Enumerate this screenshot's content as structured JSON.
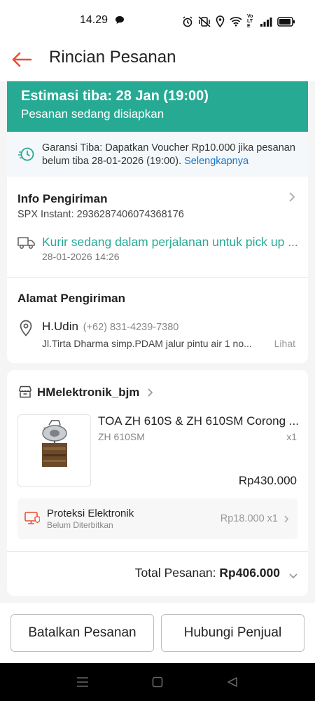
{
  "status_bar": {
    "time": "14.29",
    "network_label": "Vo LTE"
  },
  "header": {
    "title": "Rincian Pesanan"
  },
  "banner": {
    "estimate": "Estimasi tiba: 28 Jan (19:00)",
    "status": "Pesanan sedang disiapkan",
    "color": "#26aa94"
  },
  "guarantee": {
    "text": "Garansi Tiba: Dapatkan Voucher Rp10.000 jika pesanan belum tiba 28-01-2026 (19:00).",
    "link": "Selengkapnya"
  },
  "shipping": {
    "title": "Info Pengiriman",
    "tracking": "SPX Instant: 2936287406074368176",
    "status": "Kurir sedang dalam perjalanan untuk pick up ...",
    "timestamp": "28-01-2026 14:26"
  },
  "address": {
    "title": "Alamat Pengiriman",
    "name": "H.Udin",
    "phone": "(+62) 831-4239-7380",
    "line": "Jl.Tirta Dharma simp.PDAM jalur pintu air 1 no...",
    "more": "Lihat"
  },
  "order": {
    "shop_name": "HMelektronik_bjm",
    "product_name": "TOA ZH 610S & ZH 610SM Corong ...",
    "variant": "ZH 610SM",
    "qty": "x1",
    "price": "Rp430.000",
    "protection": {
      "title": "Proteksi Elektronik",
      "subtitle": "Belum Diterbitkan",
      "price": "Rp18.000 x1"
    },
    "total_label": "Total Pesanan:",
    "total_value": "Rp406.000"
  },
  "actions": {
    "cancel": "Batalkan Pesanan",
    "contact": "Hubungi Penjual"
  },
  "colors": {
    "accent": "#ee4d2d",
    "teal": "#26aa94",
    "link": "#1a73c9"
  }
}
